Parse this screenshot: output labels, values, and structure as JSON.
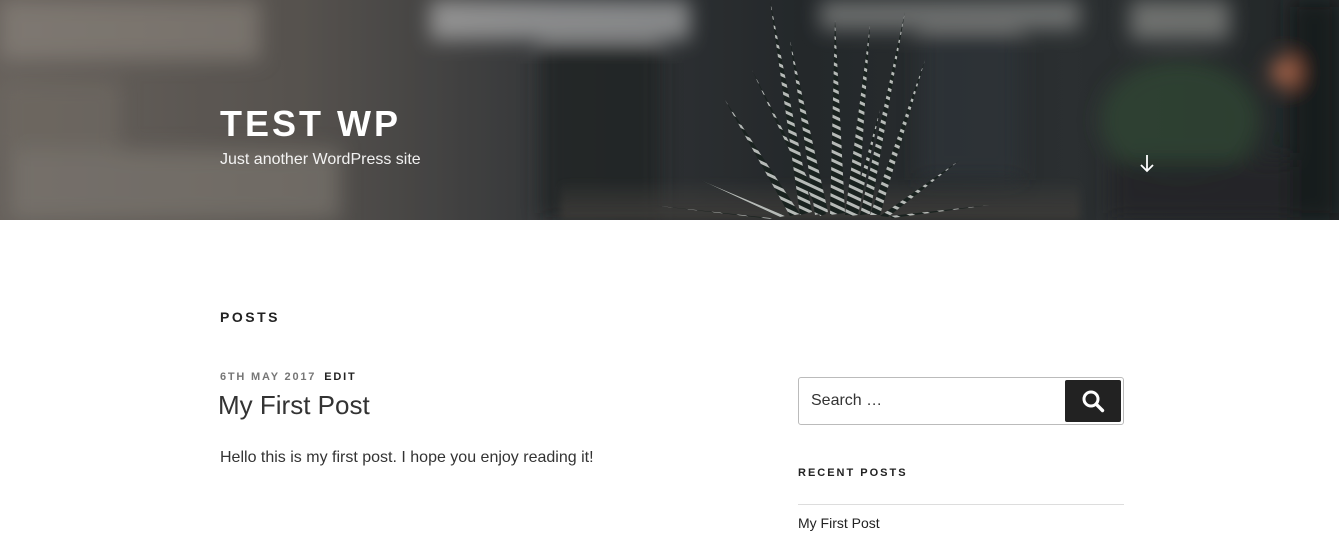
{
  "header": {
    "site_title": "TEST WP",
    "site_description": "Just another WordPress site",
    "scroll_icon": "arrow-down-icon"
  },
  "main": {
    "page_title": "POSTS",
    "post": {
      "date": "6TH MAY 2017",
      "edit_label": "EDIT",
      "title": "My First Post",
      "excerpt": "Hello this is my first post. I hope you enjoy reading it!"
    }
  },
  "sidebar": {
    "search": {
      "placeholder": "Search …",
      "icon": "search-icon"
    },
    "recent_posts": {
      "title": "RECENT POSTS",
      "items": [
        {
          "label": "My First Post"
        }
      ]
    }
  },
  "colors": {
    "text": "#333333",
    "heading": "#222222",
    "meta": "#767676",
    "button_bg": "#222222",
    "header_overlay": "#2e3336"
  }
}
